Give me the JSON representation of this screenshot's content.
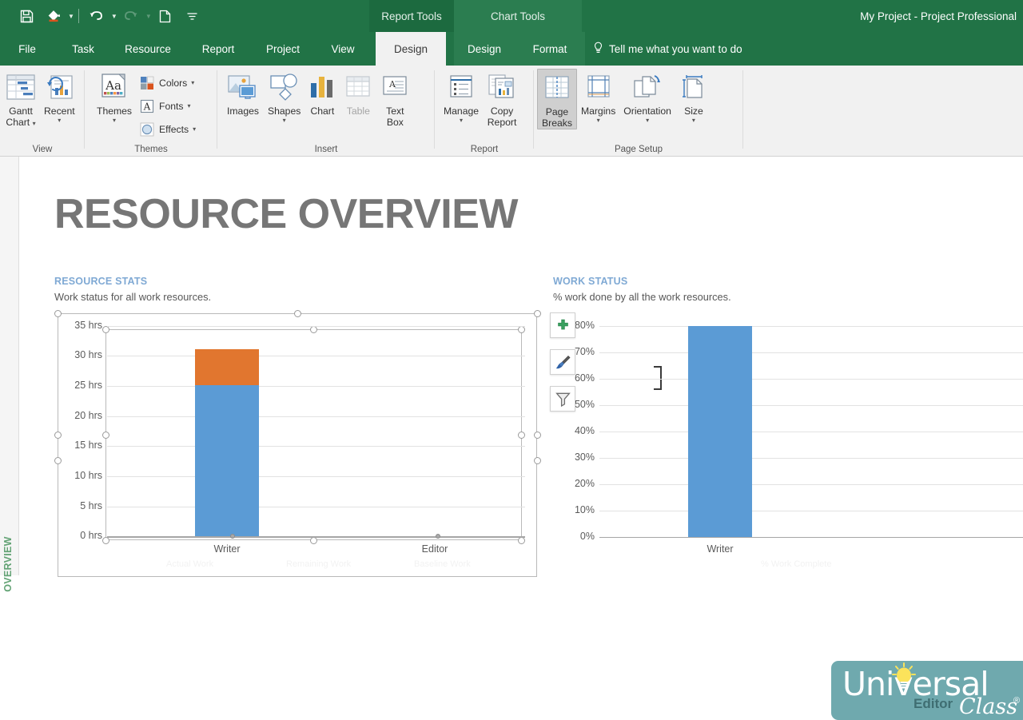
{
  "titlebar": {
    "app_title": "My Project - Project Professional",
    "quick_access": [
      {
        "name": "save",
        "icon": "save-icon"
      },
      {
        "name": "format-painter",
        "icon": "paint-bucket-icon"
      },
      {
        "name": "undo",
        "icon": "undo-icon"
      },
      {
        "name": "redo",
        "icon": "redo-icon"
      },
      {
        "name": "new",
        "icon": "page-icon"
      },
      {
        "name": "customize",
        "icon": "chevron-down-icon"
      }
    ],
    "context_tabs": [
      {
        "label": "Report Tools"
      },
      {
        "label": "Chart Tools"
      }
    ]
  },
  "ribbon": {
    "tabs": [
      {
        "label": "File",
        "active": false,
        "contextual": false
      },
      {
        "label": "Task",
        "active": false,
        "contextual": false
      },
      {
        "label": "Resource",
        "active": false,
        "contextual": false
      },
      {
        "label": "Report",
        "active": false,
        "contextual": false
      },
      {
        "label": "Project",
        "active": false,
        "contextual": false
      },
      {
        "label": "View",
        "active": false,
        "contextual": false
      },
      {
        "label": "Design",
        "active": true,
        "contextual": true
      },
      {
        "label": "Design",
        "active": false,
        "contextual": true
      },
      {
        "label": "Format",
        "active": false,
        "contextual": true
      }
    ],
    "tell_me": "Tell me what you want to do",
    "groups": [
      {
        "name": "View",
        "label": "View",
        "buttons": [
          {
            "label": "Gantt Chart",
            "icon": "gantt-chart-icon",
            "dropdown": true,
            "selected": false,
            "disabled": false
          },
          {
            "label": "Recent",
            "icon": "recent-reports-icon",
            "dropdown": true,
            "selected": false,
            "disabled": false
          }
        ]
      },
      {
        "name": "Themes",
        "label": "Themes",
        "buttons": [
          {
            "label": "Themes",
            "icon": "themes-icon",
            "dropdown": true,
            "selected": false,
            "disabled": false
          }
        ],
        "small_buttons": [
          {
            "label": "Colors",
            "icon": "colors-icon",
            "dropdown": true
          },
          {
            "label": "Fonts",
            "icon": "fonts-icon",
            "dropdown": true
          },
          {
            "label": "Effects",
            "icon": "effects-icon",
            "dropdown": true
          }
        ]
      },
      {
        "name": "Insert",
        "label": "Insert",
        "buttons": [
          {
            "label": "Images",
            "icon": "images-icon",
            "dropdown": false,
            "selected": false,
            "disabled": false
          },
          {
            "label": "Shapes",
            "icon": "shapes-icon",
            "dropdown": true,
            "selected": false,
            "disabled": false
          },
          {
            "label": "Chart",
            "icon": "chart-icon",
            "dropdown": false,
            "selected": false,
            "disabled": false
          },
          {
            "label": "Table",
            "icon": "table-icon",
            "dropdown": false,
            "selected": false,
            "disabled": true
          },
          {
            "label": "Text Box",
            "icon": "text-box-icon",
            "dropdown": false,
            "selected": false,
            "disabled": false
          }
        ]
      },
      {
        "name": "Report",
        "label": "Report",
        "buttons": [
          {
            "label": "Manage",
            "icon": "manage-icon",
            "dropdown": true,
            "selected": false,
            "disabled": false
          },
          {
            "label": "Copy Report",
            "icon": "copy-report-icon",
            "dropdown": false,
            "selected": false,
            "disabled": false
          }
        ]
      },
      {
        "name": "Page Setup",
        "label": "Page Setup",
        "buttons": [
          {
            "label": "Page Breaks",
            "icon": "page-breaks-icon",
            "dropdown": false,
            "selected": true,
            "disabled": false
          },
          {
            "label": "Margins",
            "icon": "margins-icon",
            "dropdown": true,
            "selected": false,
            "disabled": false
          },
          {
            "label": "Orientation",
            "icon": "orientation-icon",
            "dropdown": true,
            "selected": false,
            "disabled": false
          },
          {
            "label": "Size",
            "icon": "size-icon",
            "dropdown": true,
            "selected": false,
            "disabled": false
          }
        ]
      }
    ]
  },
  "sidebar": {
    "vertical_label": "OVERVIEW"
  },
  "report": {
    "title": "RESOURCE OVERVIEW",
    "sections": [
      {
        "heading": "RESOURCE STATS",
        "subtitle": "Work status for all work resources."
      },
      {
        "heading": "WORK STATUS",
        "subtitle": "% work done by all the work resources."
      }
    ]
  },
  "chart_tools_buttons": [
    {
      "name": "chart-elements",
      "icon": "plus-icon",
      "color": "#2f9e5f"
    },
    {
      "name": "chart-styles",
      "icon": "paintbrush-icon",
      "color": "#3f6fb0"
    },
    {
      "name": "chart-filters",
      "icon": "funnel-icon",
      "color": "#777777"
    }
  ],
  "watermark": {
    "universal": "Universal",
    "editor": "Editor",
    "class": "Class",
    "registered": "®",
    "bg_color": "#6fa9ae"
  },
  "colors": {
    "ribbon_green": "#217346",
    "context_green": "#2b7d50",
    "series_blue": "#5b9bd5",
    "series_orange": "#e1762f",
    "title_gray": "#767676",
    "section_blue": "#7fa9d4"
  },
  "chart_data": [
    {
      "type": "bar",
      "title": "RESOURCE STATS",
      "subtitle": "Work status for all work resources.",
      "stacked": true,
      "categories": [
        "Writer",
        "Editor"
      ],
      "series": [
        {
          "name": "Actual Work",
          "color": "#5b9bd5",
          "values": [
            25,
            0
          ]
        },
        {
          "name": "Remaining Work",
          "color": "#e1762f",
          "values": [
            6,
            0
          ]
        }
      ],
      "legend_entries": [
        "Actual Work",
        "Remaining Work",
        "Baseline Work"
      ],
      "ylabel": "",
      "xlabel": "",
      "ylim": [
        0,
        35
      ],
      "yticks": [
        "0 hrs",
        "5 hrs",
        "10 hrs",
        "15 hrs",
        "20 hrs",
        "25 hrs",
        "30 hrs",
        "35 hrs"
      ],
      "grid": true,
      "legend_position": "bottom",
      "selected": true
    },
    {
      "type": "bar",
      "title": "WORK STATUS",
      "subtitle": "% work done by all the work resources.",
      "stacked": false,
      "categories": [
        "Writer"
      ],
      "series": [
        {
          "name": "% Work Complete",
          "color": "#5b9bd5",
          "values": [
            80
          ]
        }
      ],
      "legend_entries": [
        "% Work Complete"
      ],
      "ylabel": "",
      "xlabel": "",
      "ylim": [
        0,
        80
      ],
      "yticks": [
        "0%",
        "10%",
        "20%",
        "30%",
        "40%",
        "50%",
        "60%",
        "70%",
        "80%"
      ],
      "grid": true,
      "legend_position": "bottom",
      "selected": false
    }
  ]
}
